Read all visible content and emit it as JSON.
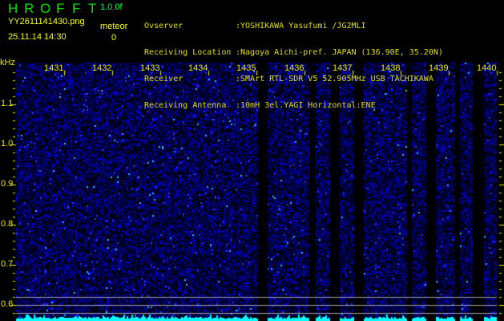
{
  "header": {
    "app_title": "HROFFT",
    "version": "1.0.0f",
    "filename": "YY2611141430.png",
    "datetime": "25.11.14 14:30",
    "meteor_label": "meteor",
    "meteor_count": "0"
  },
  "info": [
    {
      "label": "Ovserver",
      "value": ":YOSHIKAWA Yasufumi /JG2MLI"
    },
    {
      "label": "Receiving Location",
      "value": ":Nagoya Aichi-pref. JAPAN (136.90E, 35.20N)"
    },
    {
      "label": "Receiver",
      "value": ":SMArt RTL-SDR V5 52.905MHz USB TACHIKAWA"
    },
    {
      "label": "Receiving Antenna",
      "value": ":10mH 3el.YAGI Horizontal:ENE"
    }
  ],
  "plot": {
    "y_unit": "kHz",
    "y_ticks": [
      "1.1",
      "1.0",
      "0.9",
      "0.8",
      "0.7",
      "0.6"
    ],
    "time_labels": [
      "1431",
      "1432",
      "1433",
      "1434",
      "1435",
      "1436",
      "1437",
      "1438",
      "1439",
      "1440"
    ],
    "colors": {
      "text": "#e8e800",
      "noise": "#0000c0",
      "level": "#00ffff",
      "lines": "#a0a0a0"
    }
  }
}
